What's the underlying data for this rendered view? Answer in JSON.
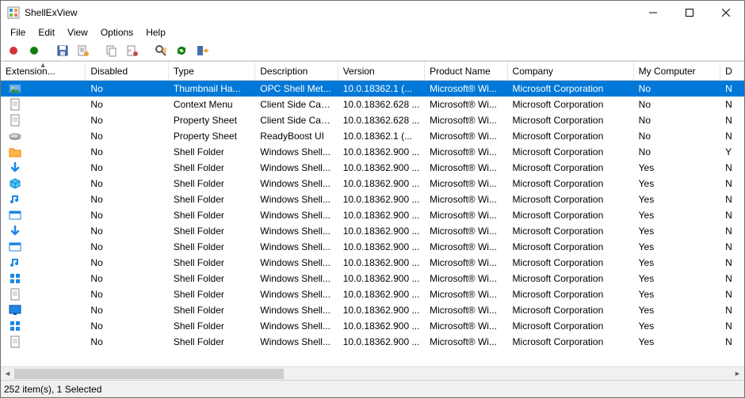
{
  "window": {
    "title": "ShellExView"
  },
  "menu": [
    "File",
    "Edit",
    "View",
    "Options",
    "Help"
  ],
  "toolbar_icons": [
    "red-dot",
    "green-dot",
    "save",
    "properties",
    "copy",
    "html-report",
    "find",
    "refresh",
    "exit"
  ],
  "columns": [
    "Extension...",
    "Disabled",
    "Type",
    "Description",
    "Version",
    "Product Name",
    "Company",
    "My Computer",
    "D"
  ],
  "sorted_column_index": 0,
  "rows": [
    {
      "sel": true,
      "icon": "image",
      "disabled": "No",
      "type": "Thumbnail Ha...",
      "desc": "OPC Shell Met...",
      "ver": "10.0.18362.1 (...",
      "prod": "Microsoft® Wi...",
      "comp": "Microsoft Corporation",
      "myc": "No",
      "d": "N"
    },
    {
      "icon": "page",
      "disabled": "No",
      "type": "Context Menu",
      "desc": "Client Side Cac...",
      "ver": "10.0.18362.628 ...",
      "prod": "Microsoft® Wi...",
      "comp": "Microsoft Corporation",
      "myc": "No",
      "d": "N"
    },
    {
      "icon": "page",
      "disabled": "No",
      "type": "Property Sheet",
      "desc": "Client Side Cac...",
      "ver": "10.0.18362.628 ...",
      "prod": "Microsoft® Wi...",
      "comp": "Microsoft Corporation",
      "myc": "No",
      "d": "N"
    },
    {
      "icon": "drive",
      "disabled": "No",
      "type": "Property Sheet",
      "desc": "ReadyBoost UI",
      "ver": "10.0.18362.1 (...",
      "prod": "Microsoft® Wi...",
      "comp": "Microsoft Corporation",
      "myc": "No",
      "d": "N"
    },
    {
      "icon": "folder-orange",
      "disabled": "No",
      "type": "Shell Folder",
      "desc": "Windows Shell...",
      "ver": "10.0.18362.900 ...",
      "prod": "Microsoft® Wi...",
      "comp": "Microsoft Corporation",
      "myc": "No",
      "d": "Y"
    },
    {
      "icon": "arrow-down",
      "disabled": "No",
      "type": "Shell Folder",
      "desc": "Windows Shell...",
      "ver": "10.0.18362.900 ...",
      "prod": "Microsoft® Wi...",
      "comp": "Microsoft Corporation",
      "myc": "Yes",
      "d": "N"
    },
    {
      "icon": "cube",
      "disabled": "No",
      "type": "Shell Folder",
      "desc": "Windows Shell...",
      "ver": "10.0.18362.900 ...",
      "prod": "Microsoft® Wi...",
      "comp": "Microsoft Corporation",
      "myc": "Yes",
      "d": "N"
    },
    {
      "icon": "music",
      "disabled": "No",
      "type": "Shell Folder",
      "desc": "Windows Shell...",
      "ver": "10.0.18362.900 ...",
      "prod": "Microsoft® Wi...",
      "comp": "Microsoft Corporation",
      "myc": "Yes",
      "d": "N"
    },
    {
      "icon": "window",
      "disabled": "No",
      "type": "Shell Folder",
      "desc": "Windows Shell...",
      "ver": "10.0.18362.900 ...",
      "prod": "Microsoft® Wi...",
      "comp": "Microsoft Corporation",
      "myc": "Yes",
      "d": "N"
    },
    {
      "icon": "arrow-down",
      "disabled": "No",
      "type": "Shell Folder",
      "desc": "Windows Shell...",
      "ver": "10.0.18362.900 ...",
      "prod": "Microsoft® Wi...",
      "comp": "Microsoft Corporation",
      "myc": "Yes",
      "d": "N"
    },
    {
      "icon": "window",
      "disabled": "No",
      "type": "Shell Folder",
      "desc": "Windows Shell...",
      "ver": "10.0.18362.900 ...",
      "prod": "Microsoft® Wi...",
      "comp": "Microsoft Corporation",
      "myc": "Yes",
      "d": "N"
    },
    {
      "icon": "music",
      "disabled": "No",
      "type": "Shell Folder",
      "desc": "Windows Shell...",
      "ver": "10.0.18362.900 ...",
      "prod": "Microsoft® Wi...",
      "comp": "Microsoft Corporation",
      "myc": "Yes",
      "d": "N"
    },
    {
      "icon": "grid",
      "disabled": "No",
      "type": "Shell Folder",
      "desc": "Windows Shell...",
      "ver": "10.0.18362.900 ...",
      "prod": "Microsoft® Wi...",
      "comp": "Microsoft Corporation",
      "myc": "Yes",
      "d": "N"
    },
    {
      "icon": "page",
      "disabled": "No",
      "type": "Shell Folder",
      "desc": "Windows Shell...",
      "ver": "10.0.18362.900 ...",
      "prod": "Microsoft® Wi...",
      "comp": "Microsoft Corporation",
      "myc": "Yes",
      "d": "N"
    },
    {
      "icon": "monitor",
      "disabled": "No",
      "type": "Shell Folder",
      "desc": "Windows Shell...",
      "ver": "10.0.18362.900 ...",
      "prod": "Microsoft® Wi...",
      "comp": "Microsoft Corporation",
      "myc": "Yes",
      "d": "N"
    },
    {
      "icon": "grid",
      "disabled": "No",
      "type": "Shell Folder",
      "desc": "Windows Shell...",
      "ver": "10.0.18362.900 ...",
      "prod": "Microsoft® Wi...",
      "comp": "Microsoft Corporation",
      "myc": "Yes",
      "d": "N"
    },
    {
      "icon": "page",
      "disabled": "No",
      "type": "Shell Folder",
      "desc": "Windows Shell...",
      "ver": "10.0.18362.900 ...",
      "prod": "Microsoft® Wi...",
      "comp": "Microsoft Corporation",
      "myc": "Yes",
      "d": "N"
    }
  ],
  "status": "252 item(s), 1 Selected",
  "scroll_arrows": {
    "left": "◄",
    "right": "►"
  }
}
